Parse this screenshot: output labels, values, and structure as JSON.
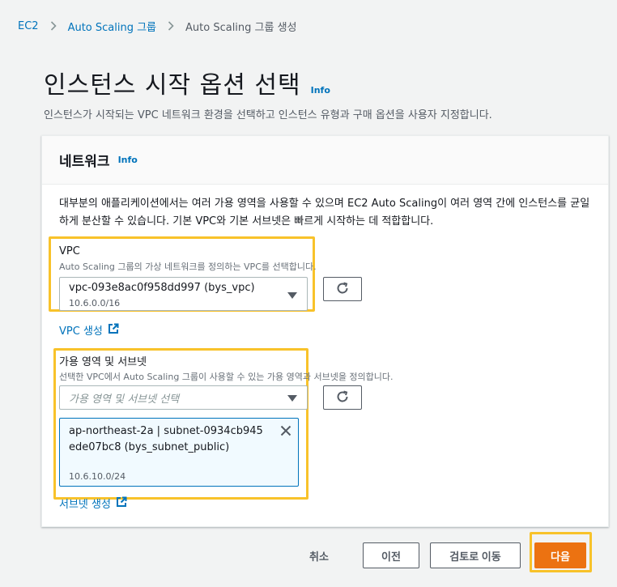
{
  "breadcrumb": {
    "items": [
      "EC2",
      "Auto Scaling 그룹",
      "Auto Scaling 그룹 생성"
    ]
  },
  "page": {
    "title": "인스턴스 시작 옵션 선택",
    "info": "Info",
    "description": "인스턴스가 시작되는 VPC 네트워크 환경을 선택하고 인스턴스 유형과 구매 옵션을 사용자 지정합니다."
  },
  "network": {
    "title": "네트워크",
    "info": "Info",
    "description": "대부분의 애플리케이션에서는 여러 가용 영역을 사용할 수 있으며 EC2 Auto Scaling이 여러 영역 간에 인스턴스를 균일하게 분산할 수 있습니다. 기본 VPC와 기본 서브넷은 빠르게 시작하는 데 적합합니다.",
    "vpc": {
      "label": "VPC",
      "description": "Auto Scaling 그룹의 가상 네트워크를 정의하는 VPC를 선택합니다.",
      "selected": "vpc-093e8ac0f958dd997 (bys_vpc)",
      "cidr": "10.6.0.0/16",
      "create_link": "VPC 생성"
    },
    "subnets": {
      "label": "가용 영역 및 서브넷",
      "description": "선택한 VPC에서 Auto Scaling 그룹이 사용할 수 있는 가용 영역과 서브넷을 정의합니다.",
      "placeholder": "가용 영역 및 서브넷 선택",
      "token": {
        "label": "ap-northeast-2a | subnet-0934cb945ede07bc8 (bys_subnet_public)",
        "cidr": "10.6.10.0/24"
      },
      "create_link": "서브넷 생성"
    }
  },
  "footer": {
    "cancel": "취소",
    "previous": "이전",
    "skip_to_review": "검토로 이동",
    "next": "다음"
  },
  "colors": {
    "accent": "#ec7211",
    "link": "#0073bb",
    "highlight": "#f8c22a"
  },
  "icons": [
    "chevron-right-icon",
    "refresh-icon",
    "external-link-icon",
    "close-icon",
    "caret-down-icon"
  ]
}
